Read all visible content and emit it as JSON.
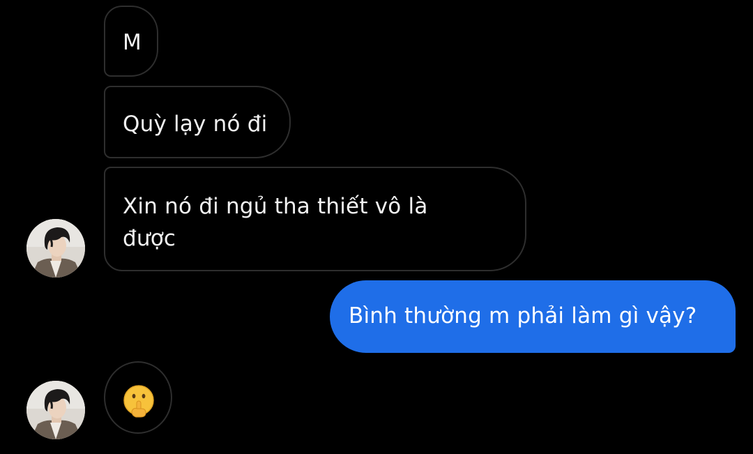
{
  "messages": [
    {
      "id": "m1",
      "direction": "incoming",
      "text": "M"
    },
    {
      "id": "m2",
      "direction": "incoming",
      "text": "Quỳ lạy nó đi"
    },
    {
      "id": "m3",
      "direction": "incoming",
      "line1": "Xin nó đi ngủ tha thiết vô là",
      "line2": "được"
    },
    {
      "id": "m4",
      "direction": "outgoing",
      "text": "Bình thường m phải làm gì vậy?"
    },
    {
      "id": "m5",
      "direction": "incoming",
      "emoji": "shushing-face-emoji"
    }
  ],
  "colors": {
    "background": "#000000",
    "incoming_border": "#2e2e2e",
    "outgoing_bubble": "#1f6ee8"
  }
}
